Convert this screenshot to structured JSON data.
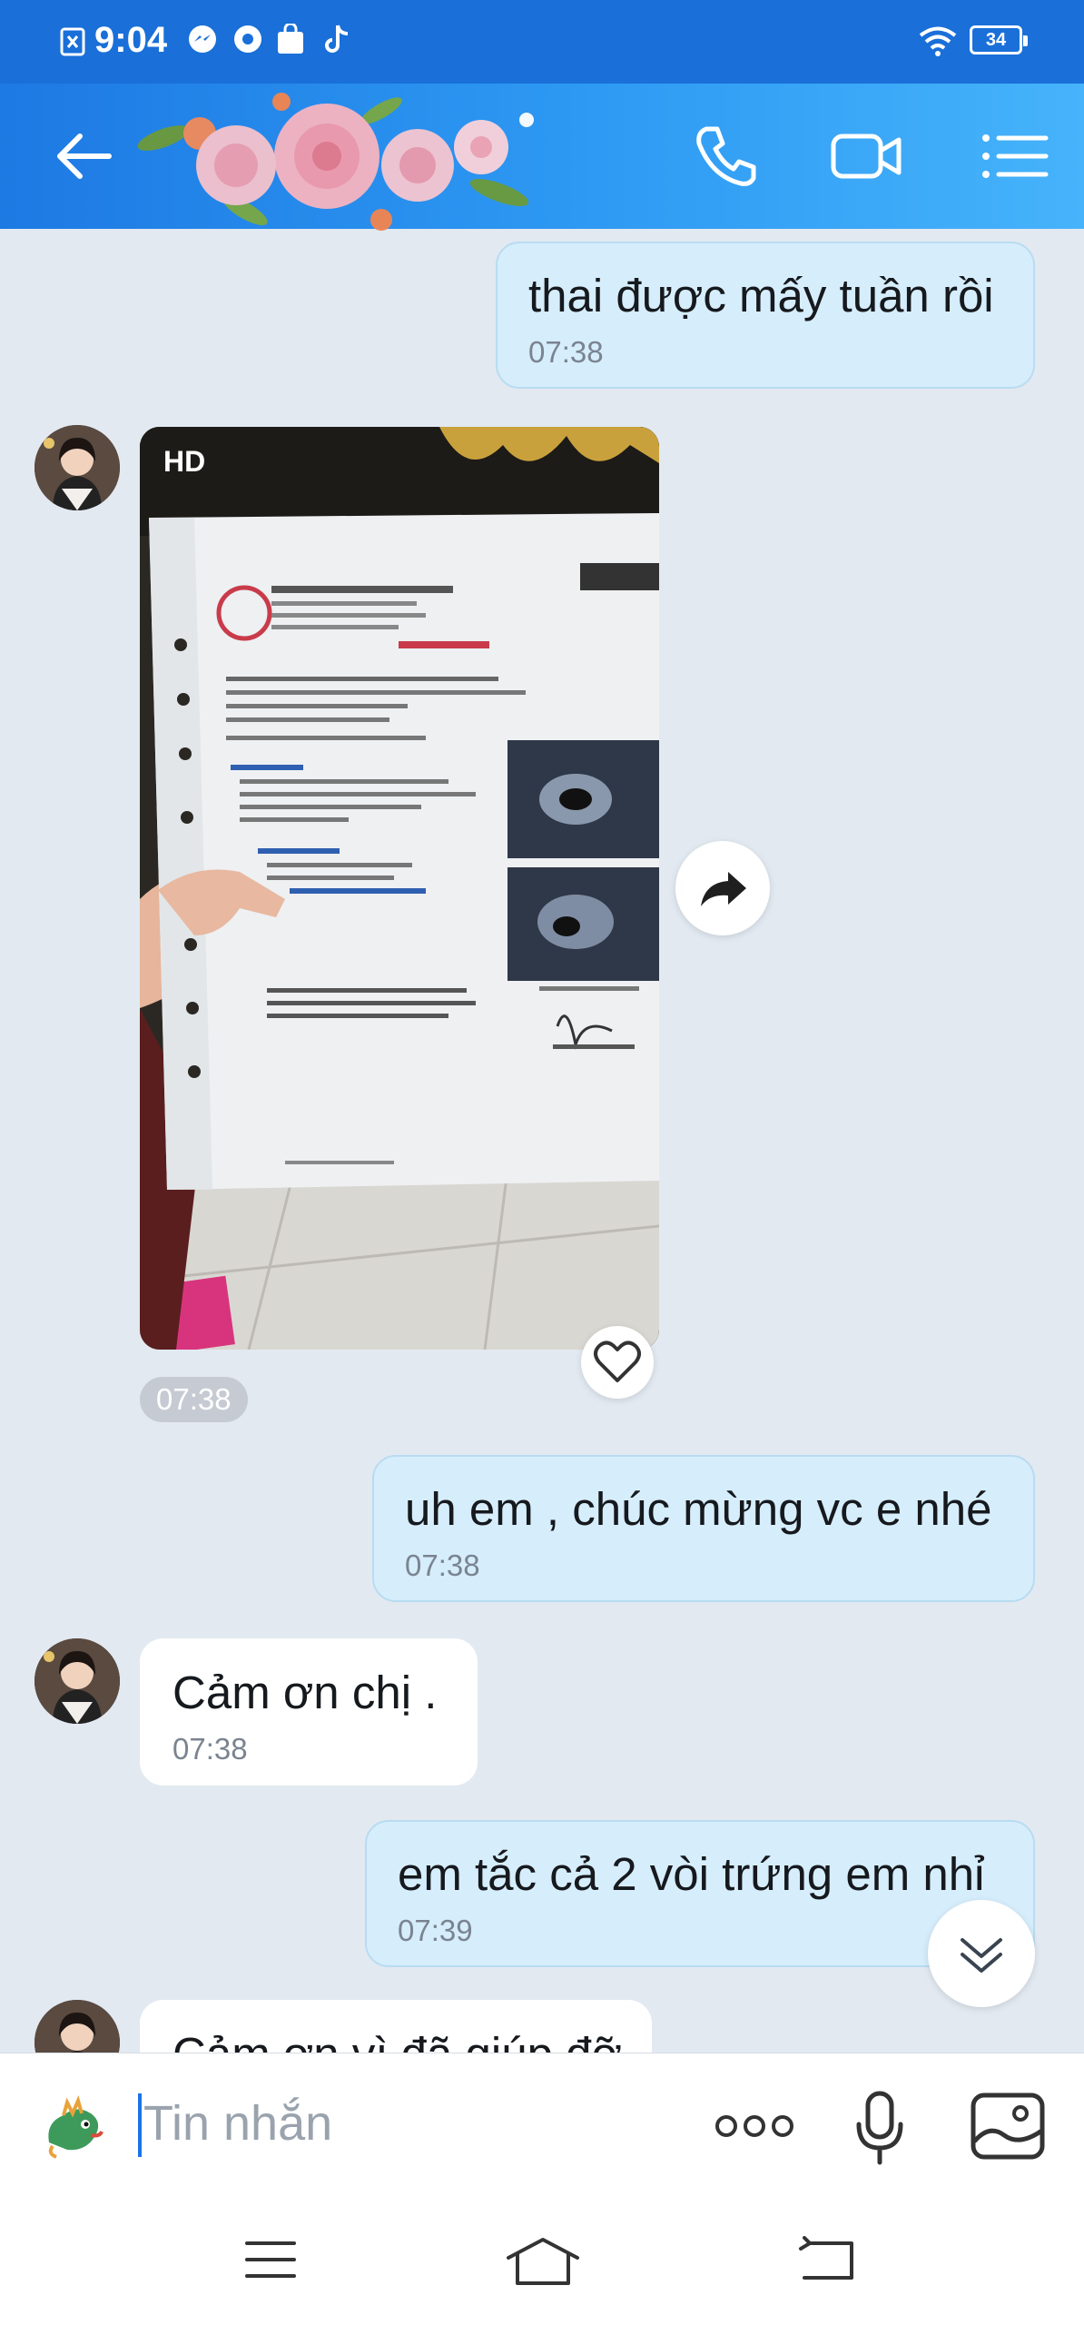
{
  "status_bar": {
    "time": "9:04",
    "battery": "34"
  },
  "header": {
    "background_color": "#1d79e3"
  },
  "messages": [
    {
      "side": "me",
      "text": "thai được mấy tuần rồi",
      "time": "07:38"
    },
    {
      "side": "them",
      "type": "image",
      "badge": "HD",
      "time": "07:38"
    },
    {
      "side": "me",
      "text": "uh em , chúc mừng vc e nhé",
      "time": "07:38"
    },
    {
      "side": "them",
      "text": "Cảm ơn chị .",
      "time": "07:38"
    },
    {
      "side": "me",
      "text": "em tắc cả 2 vòi trứng em nhỉ",
      "time": "07:39"
    },
    {
      "side": "them",
      "text": "Cảm ơn vì đã giúp đỡ",
      "time": ""
    }
  ],
  "input": {
    "placeholder": "Tin nhắn"
  },
  "colors": {
    "my_bubble": "#d6edfc",
    "their_bubble": "#ffffff",
    "chat_background": "#e2e9f1",
    "accent": "#1a73e8"
  }
}
